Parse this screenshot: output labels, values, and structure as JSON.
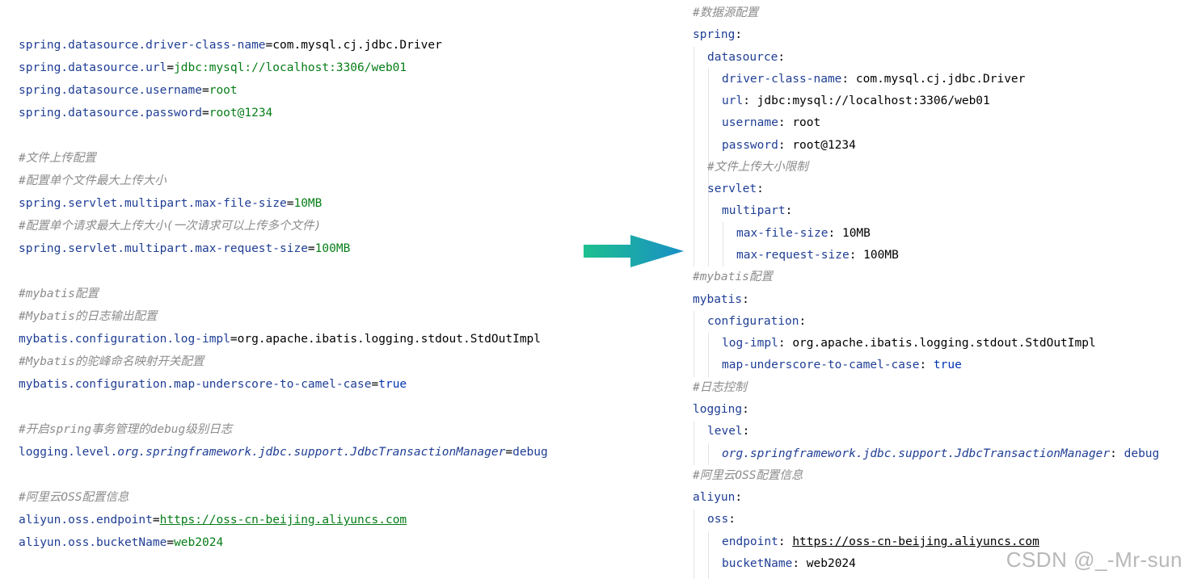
{
  "properties_file": {
    "datasource": {
      "driver_key": "spring.datasource.driver-class-name",
      "driver_value": "com.mysql.cj.jdbc.Driver",
      "url_key": "spring.datasource.url",
      "url_value": "jdbc:mysql://localhost:3306/web01",
      "username_key": "spring.datasource.username",
      "username_value": "root",
      "password_key": "spring.datasource.password",
      "password_value": "root@1234"
    },
    "upload": {
      "comment1": "#文件上传配置",
      "comment2": "#配置单个文件最大上传大小",
      "file_size_key": "spring.servlet.multipart.max-file-size",
      "file_size_value": "10MB",
      "comment3": "#配置单个请求最大上传大小(一次请求可以上传多个文件)",
      "request_size_key": "spring.servlet.multipart.max-request-size",
      "request_size_value": "100MB"
    },
    "mybatis": {
      "comment1": "#mybatis配置",
      "comment2": "#Mybatis的日志输出配置",
      "log_impl_key": "mybatis.configuration.log-impl",
      "log_impl_value": "org.apache.ibatis.logging.stdout.StdOutImpl",
      "comment3": "#Mybatis的驼峰命名映射开关配置",
      "camel_key": "mybatis.configuration.map-underscore-to-camel-case",
      "camel_value": "true"
    },
    "logging": {
      "comment": "#开启spring事务管理的debug级别日志",
      "key_prefix": "logging.level.",
      "key_italic": "org.springframework.jdbc.support.JdbcTransactionManager",
      "value": "debug"
    },
    "aliyun": {
      "comment": "#阿里云OSS配置信息",
      "endpoint_key": "aliyun.oss.endpoint",
      "endpoint_value": "https://oss-cn-beijing.aliyuncs.com",
      "bucket_key": "aliyun.oss.bucketName",
      "bucket_value": "web2024"
    }
  },
  "yaml_file": {
    "comment_datasource": "#数据源配置",
    "spring": "spring",
    "datasource": "datasource",
    "driver_key": "driver-class-name",
    "driver_value": "com.mysql.cj.jdbc.Driver",
    "url_key": "url",
    "url_value": "jdbc:mysql://localhost:3306/web01",
    "username_key": "username",
    "username_value": "root",
    "password_key": "password",
    "password_value": "root@1234",
    "comment_upload": "#文件上传大小限制",
    "servlet": "servlet",
    "multipart": "multipart",
    "file_size_key": "max-file-size",
    "file_size_value": "10MB",
    "request_size_key": "max-request-size",
    "request_size_value": "100MB",
    "comment_mybatis": "#mybatis配置",
    "mybatis": "mybatis",
    "configuration": "configuration",
    "log_impl_key": "log-impl",
    "log_impl_value": "org.apache.ibatis.logging.stdout.StdOutImpl",
    "camel_key": "map-underscore-to-camel-case",
    "camel_value": "true",
    "comment_logging": "#日志控制",
    "logging": "logging",
    "level": "level",
    "tx_manager_key": "org.springframework.jdbc.support.JdbcTransactionManager",
    "tx_manager_value": "debug",
    "comment_aliyun": "#阿里云OSS配置信息",
    "aliyun": "aliyun",
    "oss": "oss",
    "endpoint_key": "endpoint",
    "endpoint_value": "https://oss-cn-beijing.aliyuncs.com",
    "bucket_key": "bucketName",
    "bucket_value": "web2024"
  },
  "colors": {
    "key": "#1f3e95",
    "string_value": "#067d17",
    "comment": "#8c8c8c",
    "arrow_start": "#1dbf8f",
    "arrow_end": "#1a8fc6"
  },
  "watermark": "CSDN @_-Mr-sun"
}
